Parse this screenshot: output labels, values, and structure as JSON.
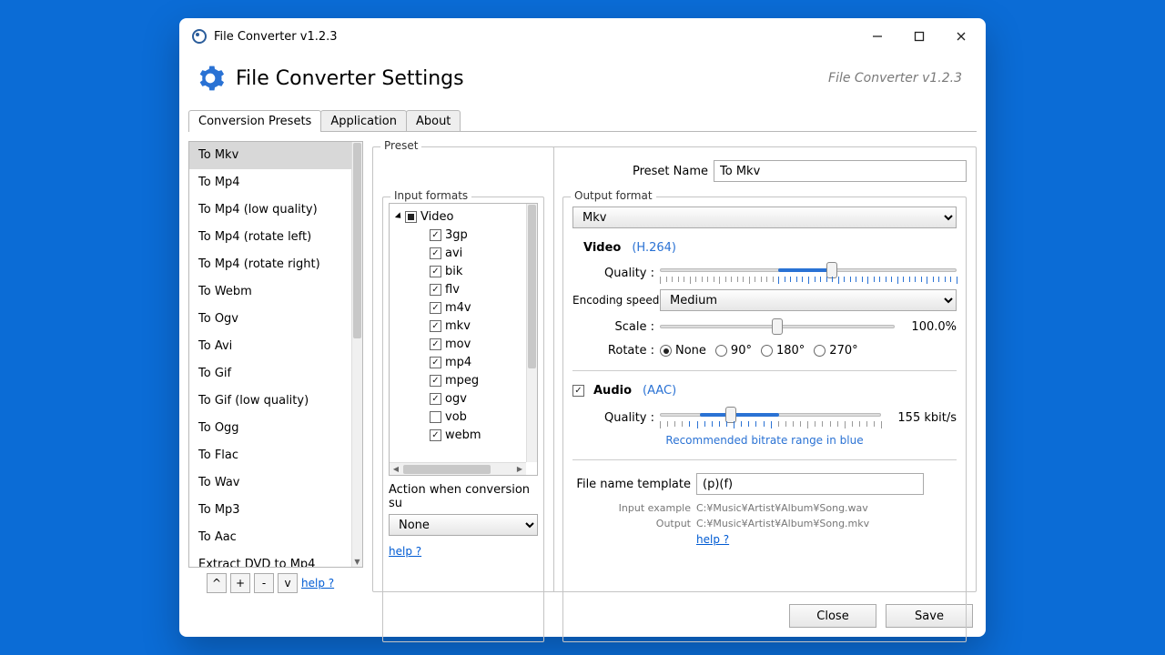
{
  "window": {
    "title": "File Converter v1.2.3"
  },
  "header": {
    "title": "File Converter Settings",
    "version_label": "File Converter v1.2.3"
  },
  "tabs": [
    "Conversion Presets",
    "Application",
    "About"
  ],
  "presets": {
    "items": [
      "To Mkv",
      "To Mp4",
      "To Mp4 (low quality)",
      "To Mp4 (rotate left)",
      "To Mp4 (rotate right)",
      "To Webm",
      "To Ogv",
      "To Avi",
      "To Gif",
      "To Gif (low quality)",
      "To Ogg",
      "To Flac",
      "To Wav",
      "To Mp3",
      "To Aac",
      "Extract DVD to Mp4"
    ],
    "selected_index": 0,
    "buttons": {
      "up": "^",
      "add": "+",
      "remove": "-",
      "down": "v",
      "help": "help ?"
    }
  },
  "input_formats": {
    "group_label": "Input formats",
    "category": "Video",
    "items": [
      {
        "name": "3gp",
        "checked": true
      },
      {
        "name": "avi",
        "checked": true
      },
      {
        "name": "bik",
        "checked": true
      },
      {
        "name": "flv",
        "checked": true
      },
      {
        "name": "m4v",
        "checked": true
      },
      {
        "name": "mkv",
        "checked": true
      },
      {
        "name": "mov",
        "checked": true
      },
      {
        "name": "mp4",
        "checked": true
      },
      {
        "name": "mpeg",
        "checked": true
      },
      {
        "name": "ogv",
        "checked": true
      },
      {
        "name": "vob",
        "checked": false
      },
      {
        "name": "webm",
        "checked": true
      }
    ],
    "action_label": "Action when conversion su",
    "action_value": "None",
    "help": "help ?"
  },
  "preset_panel": {
    "group_label": "Preset",
    "name_label": "Preset Name",
    "name_value": "To Mkv",
    "output_group": "Output format",
    "output_value": "Mkv",
    "video": {
      "label": "Video",
      "codec": "(H.264)",
      "quality_label": "Quality :",
      "enc_label": "Encoding speed :",
      "enc_value": "Medium",
      "scale_label": "Scale :",
      "scale_value": "100.0%",
      "rotate_label": "Rotate :",
      "rotate_options": [
        "None",
        "90°",
        "180°",
        "270°"
      ],
      "rotate_selected": 0
    },
    "audio": {
      "label": "Audio",
      "codec": "(AAC)",
      "checked": true,
      "quality_label": "Quality :",
      "bitrate": "155 kbit/s",
      "note": "Recommended bitrate range in blue"
    },
    "filename": {
      "label": "File name template",
      "value": "(p)(f)",
      "input_example_label": "Input example",
      "input_example": "C:¥Music¥Artist¥Album¥Song.wav",
      "output_label": "Output",
      "output_value": "C:¥Music¥Artist¥Album¥Song.mkv",
      "help": "help ?"
    }
  },
  "footer": {
    "close": "Close",
    "save": "Save"
  },
  "colors": {
    "accent": "#2a72d4"
  }
}
